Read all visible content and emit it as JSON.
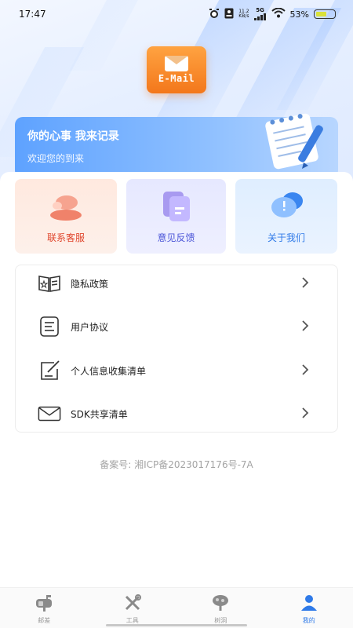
{
  "status_bar": {
    "time": "17:47",
    "net_speed_value": "11.2",
    "net_speed_unit": "KB/s",
    "network": "5G",
    "battery": "53%"
  },
  "app": {
    "logo_text": "E-Mail"
  },
  "banner": {
    "title": "你的心事 我来记录",
    "subtitle": "欢迎您的到来"
  },
  "quick_cards": [
    {
      "label": "联系客服",
      "color": "#e0462d"
    },
    {
      "label": "意见反馈",
      "color": "#4c56d8"
    },
    {
      "label": "关于我们",
      "color": "#2f7ae8"
    }
  ],
  "menu": [
    {
      "label": "隐私政策",
      "icon": "privacy-book-icon"
    },
    {
      "label": "用户协议",
      "icon": "document-icon"
    },
    {
      "label": "个人信息收集清单",
      "icon": "edit-note-icon"
    },
    {
      "label": "SDK共享清单",
      "icon": "mail-icon"
    }
  ],
  "icp": "备案号: 湘ICP备2023017176号-7A",
  "tabs": [
    {
      "label": "邮差",
      "icon": "mailbox-icon",
      "active": false
    },
    {
      "label": "工具",
      "icon": "tools-icon",
      "active": false
    },
    {
      "label": "树洞",
      "icon": "tree-icon",
      "active": false
    },
    {
      "label": "我的",
      "icon": "person-icon",
      "active": true
    }
  ],
  "accent": "#2f7ae8"
}
